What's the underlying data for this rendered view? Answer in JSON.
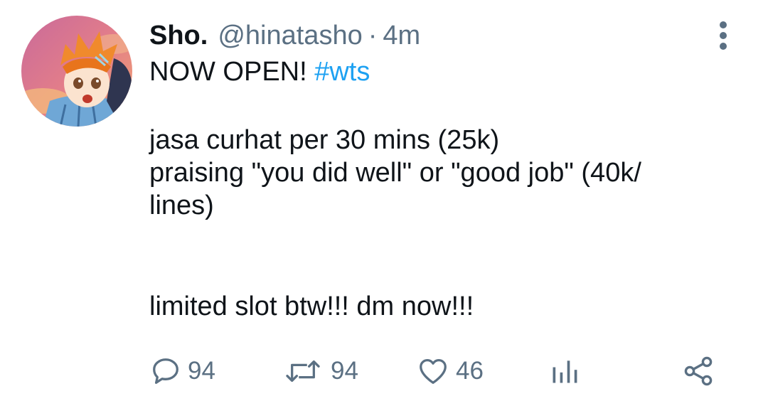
{
  "tweet": {
    "display_name": "Sho.",
    "handle": "@hinatasho",
    "separator": "·",
    "timestamp": "4m",
    "line1_text": "NOW OPEN! ",
    "hashtag": "#wts",
    "line2": "jasa curhat per 30 mins (25k)",
    "line3": "praising \"you did well\" or \"good job\" (40k/",
    "line4": "lines)",
    "line5": "limited slot btw!!! dm now!!!"
  },
  "actions": {
    "reply_count": "94",
    "retweet_count": "94",
    "like_count": "46"
  },
  "icons": {
    "reply": "speech-bubble-icon",
    "retweet": "retweet-arrows-icon",
    "like": "heart-icon",
    "analytics": "bar-chart-icon",
    "share": "share-nodes-icon",
    "more": "vertical-ellipsis-icon"
  },
  "colors": {
    "text": "#0f1419",
    "secondary": "#5b7083",
    "link": "#1da1f2"
  }
}
